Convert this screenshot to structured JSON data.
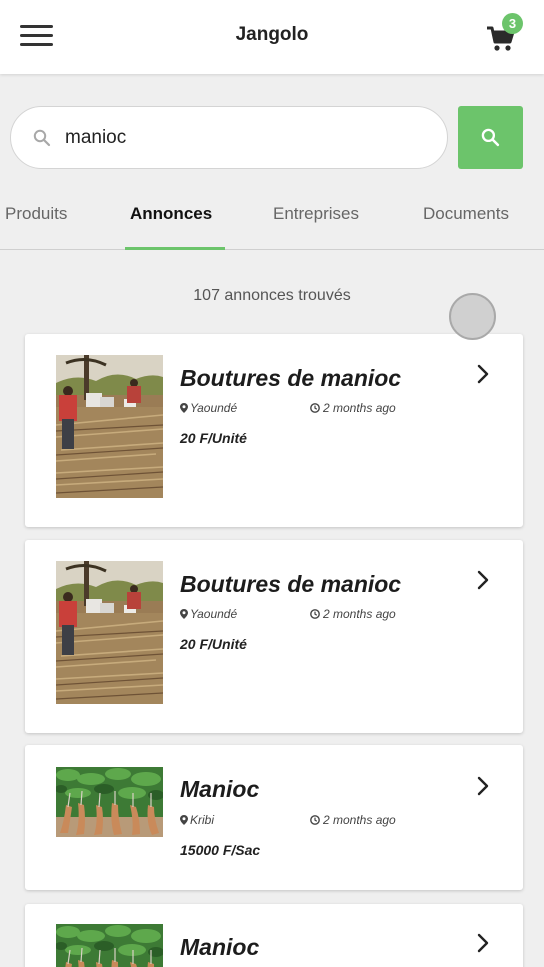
{
  "header": {
    "title": "Jangolo",
    "cart_count": "3",
    "menu_icon": "hamburger-menu-icon",
    "cart_icon": "shopping-cart-icon"
  },
  "search": {
    "value": "manioc",
    "placeholder": "",
    "icon": "search-icon"
  },
  "tabs": [
    {
      "label": "Produits",
      "active": false
    },
    {
      "label": "Annonces",
      "active": true
    },
    {
      "label": "Entreprises",
      "active": false
    },
    {
      "label": "Documents",
      "active": false
    }
  ],
  "results": {
    "count_text": "107 annonces trouvés"
  },
  "colors": {
    "accent": "#6cc46b",
    "background": "#efefef",
    "card": "#ffffff"
  },
  "listings": [
    {
      "title": "Boutures de manioc",
      "location": "Yaoundé",
      "time": "2 months ago",
      "price": "20 F/Unité",
      "image": "cassava-cuttings-photo"
    },
    {
      "title": "Boutures de manioc",
      "location": "Yaoundé",
      "time": "2 months ago",
      "price": "20 F/Unité",
      "image": "cassava-cuttings-photo"
    },
    {
      "title": "Manioc",
      "location": "Kribi",
      "time": "2 months ago",
      "price": "15000 F/Sac",
      "image": "cassava-roots-photo"
    },
    {
      "title": "Manioc",
      "location": "",
      "time": "",
      "price": "",
      "image": "cassava-roots-photo"
    }
  ]
}
